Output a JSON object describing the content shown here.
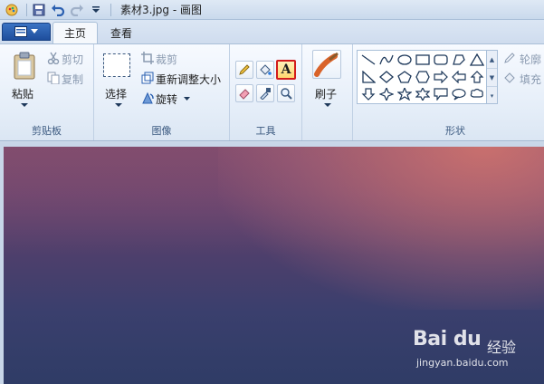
{
  "window": {
    "title": "素材3.jpg - 画图"
  },
  "tabs": [
    {
      "label": "主页",
      "active": true
    },
    {
      "label": "查看",
      "active": false
    }
  ],
  "clipboard": {
    "paste_label": "粘贴",
    "cut_label": "剪切",
    "copy_label": "复制",
    "group_label": "剪贴板"
  },
  "image": {
    "select_label": "选择",
    "crop_label": "裁剪",
    "resize_label": "重新调整大小",
    "rotate_label": "旋转",
    "group_label": "图像"
  },
  "tools": {
    "group_label": "工具",
    "text_tool_glyph": "A"
  },
  "brushes": {
    "label": "刷子"
  },
  "shapes": {
    "group_label": "形状",
    "outline_label": "轮廓",
    "fill_label": "填充"
  },
  "watermark": {
    "logo": "Bai du",
    "brand_cn": "经验",
    "url": "jingyan.baidu.com"
  },
  "colors": {
    "accent_red": "#d21b1b",
    "file_button": "#2a5fb0"
  }
}
